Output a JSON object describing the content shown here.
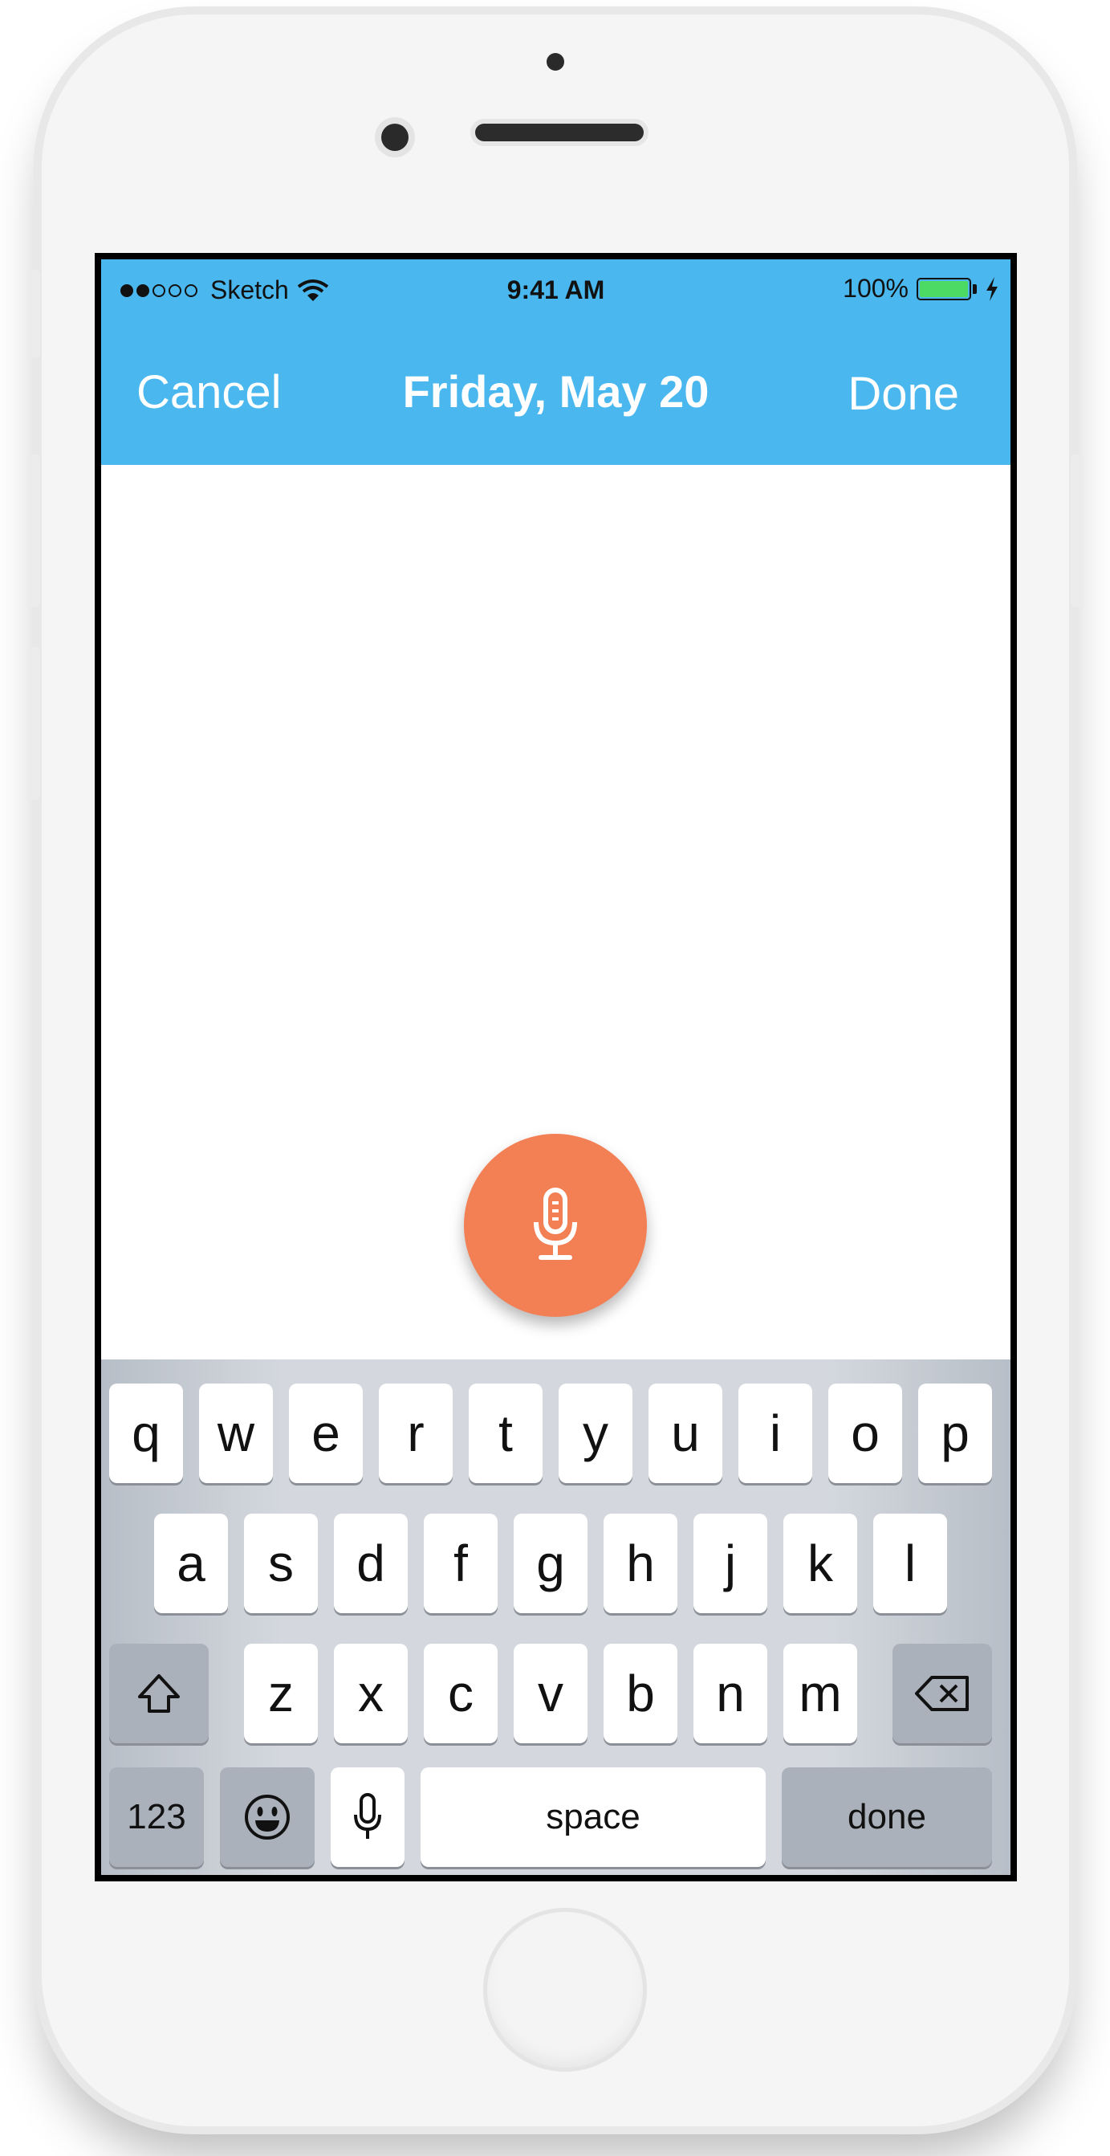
{
  "status_bar": {
    "signal_full": 2,
    "signal_empty": 3,
    "carrier": "Sketch",
    "time": "9:41 AM",
    "battery_percent": "100%",
    "battery_level": 1.0,
    "battery_color": "#4cd964"
  },
  "nav": {
    "cancel_label": "Cancel",
    "title": "Friday, May 20",
    "done_label": "Done",
    "background_color": "#4ab8ef"
  },
  "record_button": {
    "icon": "microphone-icon",
    "color": "#f37f55"
  },
  "keyboard": {
    "row1": [
      "q",
      "w",
      "e",
      "r",
      "t",
      "y",
      "u",
      "i",
      "o",
      "p"
    ],
    "row2": [
      "a",
      "s",
      "d",
      "f",
      "g",
      "h",
      "j",
      "k",
      "l"
    ],
    "row3": [
      "z",
      "x",
      "c",
      "v",
      "b",
      "n",
      "m"
    ],
    "shift_icon": "shift-arrow-icon",
    "delete_icon": "backspace-icon",
    "numbers_label": "123",
    "emoji_icon": "emoji-icon",
    "dictation_icon": "microphone-icon",
    "space_label": "space",
    "done_label": "done"
  }
}
